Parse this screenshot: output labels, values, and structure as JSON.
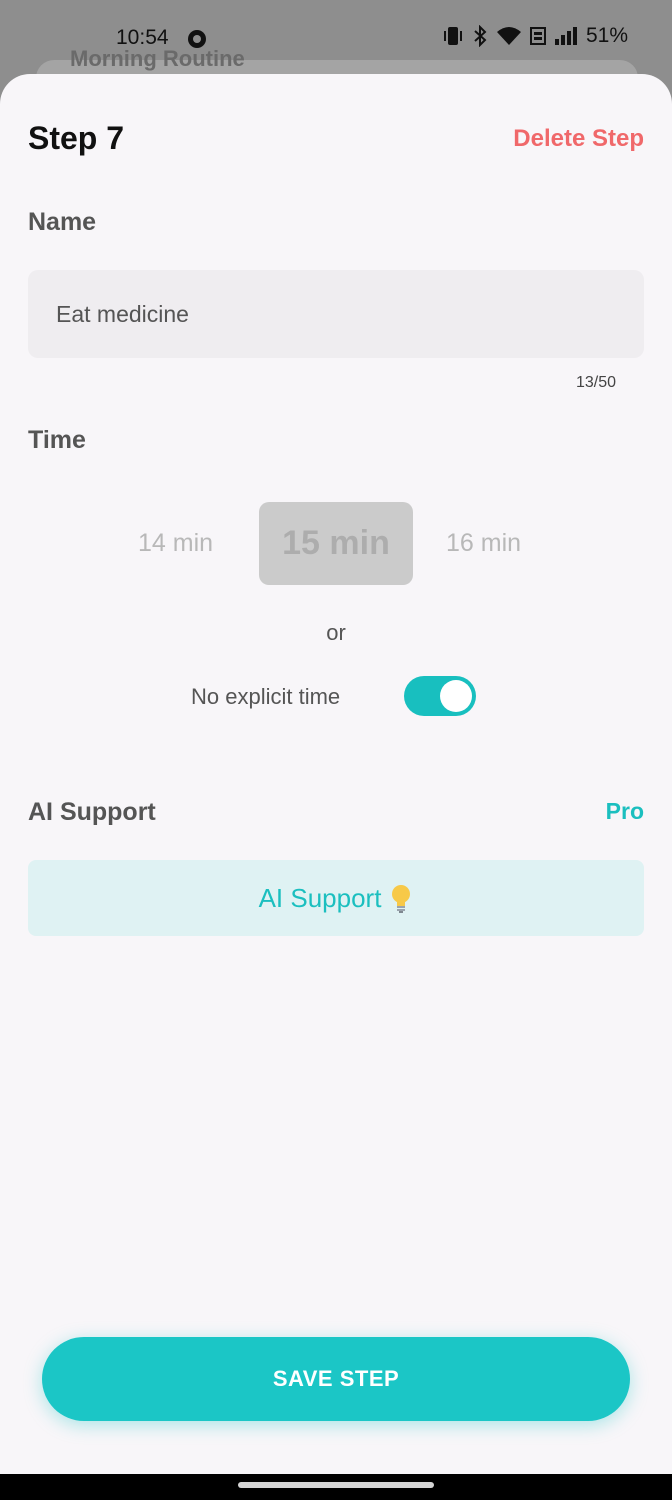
{
  "backdrop": {
    "title": "Morning Routine"
  },
  "status_bar": {
    "time": "10:54",
    "battery": "51%"
  },
  "sheet": {
    "title": "Step 7",
    "delete_label": "Delete Step",
    "name_section": {
      "label": "Name",
      "value": "Eat medicine",
      "char_count": "13/50"
    },
    "time_section": {
      "label": "Time",
      "options": [
        "14 min",
        "15 min",
        "16 min"
      ],
      "selected": "15 min",
      "or_text": "or",
      "no_explicit_label": "No explicit time",
      "no_explicit_enabled": true
    },
    "ai_section": {
      "label": "AI Support",
      "badge": "Pro",
      "button_label": "AI Support"
    },
    "save_label": "SAVE STEP"
  },
  "colors": {
    "accent": "#1bc6c6",
    "danger": "#f0686a",
    "sheet_bg": "#f8f6f9"
  }
}
